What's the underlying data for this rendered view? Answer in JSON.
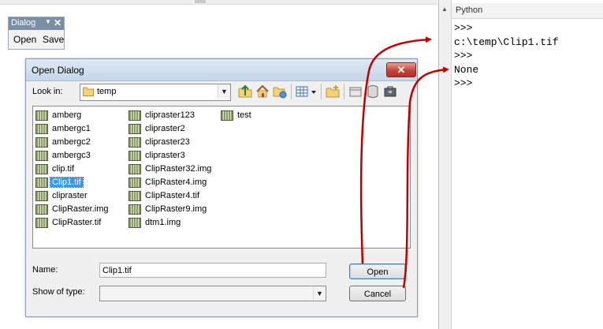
{
  "toolbar": {
    "title": "Dialog",
    "dropdown_icon": "dropdown-arrow-icon",
    "close_icon": "close-icon",
    "open_label": "Open",
    "save_label": "Save"
  },
  "dialog": {
    "title": "Open Dialog",
    "look_in_label": "Look in:",
    "look_in_value": "temp",
    "toolbar_icons": [
      "up-folder-icon",
      "home-icon",
      "connect-folder-icon",
      "view-menu-icon",
      "new-folder-icon",
      "catalog-icon",
      "database-icon",
      "toolbox-icon"
    ],
    "files": {
      "column1": [
        "amberg",
        "ambergc1",
        "ambergc2",
        "ambergc3",
        "clip.tif",
        "Clip1.tif",
        "clipraster",
        "ClipRaster.img",
        "ClipRaster.tif"
      ],
      "column2": [
        "clipraster123",
        "clipraster2",
        "clipraster23",
        "clipraster3",
        "ClipRaster32.img",
        "ClipRaster4.img",
        "ClipRaster4.tif",
        "ClipRaster9.img",
        "dtm1.img"
      ],
      "column3": [
        "test"
      ]
    },
    "selected_file": "Clip1.tif",
    "name_label": "Name:",
    "name_value": "Clip1.tif",
    "type_label": "Show of type:",
    "type_value": "",
    "open_button": "Open",
    "cancel_button": "Cancel"
  },
  "python": {
    "title": "Python",
    "lines": [
      ">>>",
      "c:\\temp\\Clip1.tif",
      ">>>",
      "None",
      ">>>"
    ]
  },
  "colors": {
    "arrow": "#c00000",
    "selection": "#3399ff",
    "toolbar_title": "#7c8ea6"
  }
}
